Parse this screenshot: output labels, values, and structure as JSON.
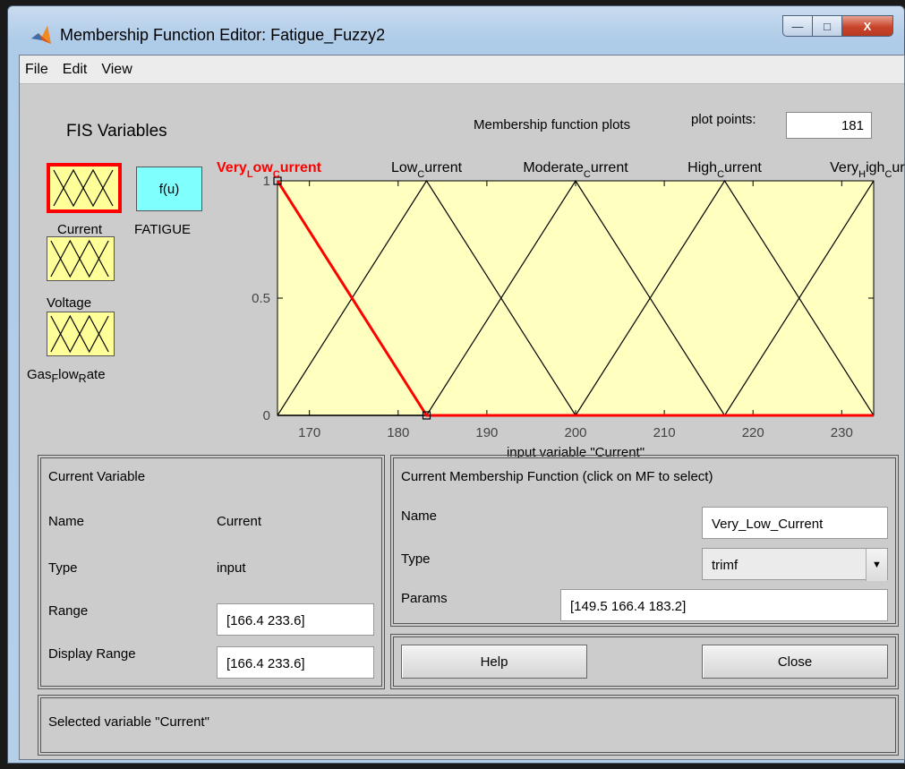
{
  "window": {
    "title": "Membership Function Editor: Fatigue_Fuzzy2",
    "minimize": "—",
    "maximize": "□",
    "close": "X"
  },
  "menu": [
    "File",
    "Edit",
    "View"
  ],
  "fis": {
    "heading": "FIS Variables",
    "output_label": "f(u)",
    "current_caption": "Current",
    "output_caption": "FATIGUE",
    "voltage_caption": "Voltage",
    "gas_caption_a": "Gas",
    "gas_caption_b": "F",
    "gas_caption_c": "low",
    "gas_caption_d": "R",
    "gas_caption_e": "ate"
  },
  "plot": {
    "heading": "Membership function plots",
    "points_label": "plot points:",
    "points_value": "181"
  },
  "chart_data": {
    "type": "line",
    "xlabel": "input variable \"Current\"",
    "xlim": [
      166.4,
      233.6
    ],
    "ylim": [
      0,
      1
    ],
    "xticks": [
      170,
      180,
      190,
      200,
      210,
      220,
      230
    ],
    "yticks": [
      0,
      0.5,
      1
    ],
    "yticklabels": [
      "0",
      "0.5",
      "1"
    ],
    "series": [
      {
        "name": "Very_Low_Current",
        "label": [
          "Very",
          "L",
          "ow",
          "C",
          "urrent"
        ],
        "params": [
          149.5,
          166.4,
          183.2
        ],
        "selected": true,
        "color": "#ff0000"
      },
      {
        "name": "Low_Current",
        "label": [
          "Low",
          "C",
          "urrent"
        ],
        "params": [
          166.4,
          183.2,
          200
        ],
        "color": "#000000"
      },
      {
        "name": "Moderate_Current",
        "label": [
          "Moderate",
          "C",
          "urrent"
        ],
        "params": [
          183.2,
          200,
          216.8
        ],
        "color": "#000000"
      },
      {
        "name": "High_Current",
        "label": [
          "High",
          "C",
          "urrent"
        ],
        "params": [
          200,
          216.8,
          233.6
        ],
        "color": "#000000"
      },
      {
        "name": "Very_High_Current",
        "label": [
          "Very",
          "H",
          "igh",
          "C",
          "urre"
        ],
        "params": [
          216.8,
          233.6,
          250.4
        ],
        "color": "#000000"
      }
    ],
    "background": "#ffffc0"
  },
  "current_variable": {
    "heading": "Current Variable",
    "name_label": "Name",
    "name_value": "Current",
    "type_label": "Type",
    "type_value": "input",
    "range_label": "Range",
    "range_value": "[166.4 233.6]",
    "display_range_label": "Display Range",
    "display_range_value": "[166.4 233.6]"
  },
  "current_mf": {
    "heading": "Current Membership Function (click on MF to select)",
    "name_label": "Name",
    "name_value": "Very_Low_Current",
    "type_label": "Type",
    "type_value": "trimf",
    "params_label": "Params",
    "params_value": "[149.5 166.4 183.2]"
  },
  "buttons": {
    "help": "Help",
    "close": "Close"
  },
  "status": "Selected variable \"Current\""
}
